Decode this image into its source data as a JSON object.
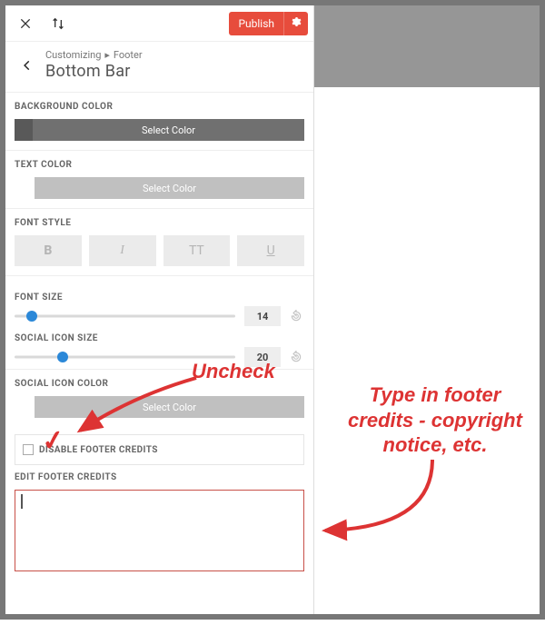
{
  "toolbar": {
    "publish_label": "Publish"
  },
  "breadcrumb": {
    "root": "Customizing",
    "parent": "Footer",
    "title": "Bottom Bar"
  },
  "sections": {
    "bg_color": {
      "label": "BACKGROUND COLOR",
      "btn": "Select Color"
    },
    "text_color": {
      "label": "TEXT COLOR",
      "btn": "Select Color"
    },
    "font_style": {
      "label": "FONT STYLE",
      "b": "B",
      "i": "I",
      "tt": "TT",
      "u": "U"
    },
    "font_size": {
      "label": "FONT SIZE",
      "value": "14"
    },
    "social_size": {
      "label": "SOCIAL ICON SIZE",
      "value": "20"
    },
    "social_color": {
      "label": "SOCIAL ICON COLOR",
      "btn": "Select Color"
    },
    "disable_credits": {
      "label": "DISABLE FOOTER CREDITS"
    },
    "edit_credits": {
      "label": "EDIT FOOTER CREDITS"
    }
  },
  "annotations": {
    "uncheck": "Uncheck",
    "type_note": "Type in footer credits - copyright notice, etc."
  }
}
